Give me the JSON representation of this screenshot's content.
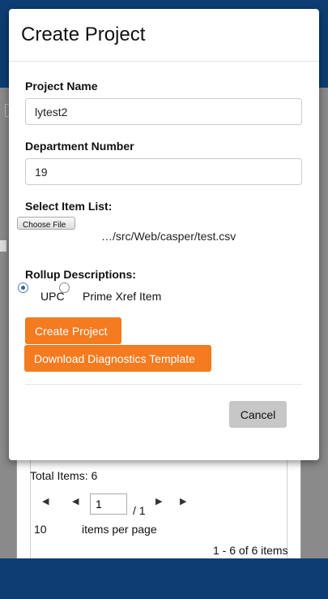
{
  "dialog": {
    "title": "Create Project",
    "project_name": {
      "label": "Project Name",
      "value": "lytest2"
    },
    "department_number": {
      "label": "Department Number",
      "value": "19"
    },
    "item_list": {
      "label": "Select Item List:",
      "button_label": "Choose File",
      "file_name": "…/src/Web/casper/test.csv"
    },
    "rollup": {
      "label": "Rollup Descriptions:",
      "options": [
        {
          "label": "UPC",
          "checked": true
        },
        {
          "label": "Prime Xref Item",
          "checked": false
        }
      ]
    },
    "buttons": {
      "create": "Create Project",
      "download": "Download Diagnostics Template",
      "cancel": "Cancel"
    }
  },
  "background": {
    "total_items": "Total Items: 6",
    "pager": {
      "first_icon": "first-page-icon",
      "prev_icon": "prev-page-icon",
      "next_icon": "next-page-icon",
      "last_icon": "last-page-icon",
      "page_value": "1",
      "of_pages": "/ 1",
      "per_page_count": "10",
      "per_page_label": "items per page",
      "range": "1 - 6 of 6 items"
    }
  },
  "colors": {
    "header_blue": "#0d3d72",
    "accent_orange": "#f47b20",
    "cancel_gray": "#c7c7c7"
  }
}
